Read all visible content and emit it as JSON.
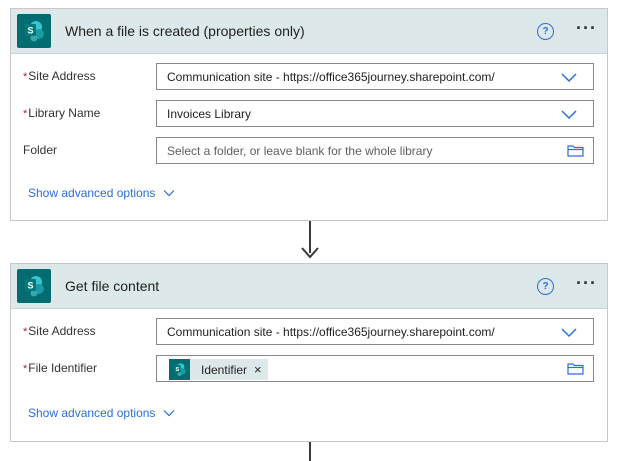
{
  "card1": {
    "title": "When a file is created (properties only)",
    "help_icon": "question-circle-icon",
    "help_text": "?",
    "more_text": "···",
    "fields": [
      {
        "label": "Site Address",
        "required": true,
        "value": "Communication site - https://office365journey.sharepoint.com/",
        "control": "dropdown"
      },
      {
        "label": "Library Name",
        "required": true,
        "value": "Invoices Library",
        "control": "dropdown"
      },
      {
        "label": "Folder",
        "required": false,
        "placeholder": "Select a folder, or leave blank for the whole library",
        "control": "folder-picker"
      }
    ],
    "advanced_label": "Show advanced options"
  },
  "card2": {
    "title": "Get file content",
    "help_text": "?",
    "more_text": "···",
    "fields": [
      {
        "label": "Site Address",
        "required": true,
        "value": "Communication site - https://office365journey.sharepoint.com/",
        "control": "dropdown"
      },
      {
        "label": "File Identifier",
        "required": true,
        "token": "Identifier",
        "control": "folder-picker"
      }
    ],
    "advanced_label": "Show advanced options"
  },
  "required_mark": "*",
  "token_remove": "×",
  "colors": {
    "header_bg": "#dce8e9",
    "sharepoint_teal": "#036c70",
    "link_blue": "#2b6fd6",
    "required_red": "#a4262c"
  }
}
